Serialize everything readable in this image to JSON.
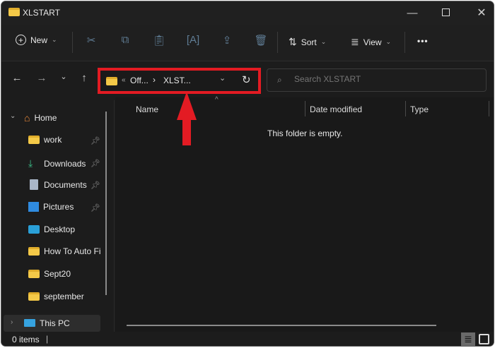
{
  "window": {
    "title": "XLSTART"
  },
  "toolbar": {
    "new_label": "New",
    "sort_label": "Sort",
    "view_label": "View",
    "more_label": "•••",
    "icons": [
      "plus-circle-icon",
      "cut-icon",
      "copy-icon",
      "paste-icon",
      "rename-icon",
      "share-icon",
      "delete-icon",
      "sort-icon",
      "view-icon",
      "more-icon"
    ]
  },
  "address": {
    "overflow": "«",
    "crumbs": [
      "Off...",
      "XLST..."
    ],
    "separator": "›"
  },
  "search": {
    "placeholder": "Search XLSTART"
  },
  "columns": [
    "Name",
    "Date modified",
    "Type"
  ],
  "empty_message": "This folder is empty.",
  "sidebar": {
    "home": "Home",
    "items": [
      {
        "label": "work",
        "icon": "folder-icon",
        "pinned": true
      },
      {
        "label": "Downloads",
        "icon": "download-icon",
        "pinned": true
      },
      {
        "label": "Documents",
        "icon": "documents-icon",
        "pinned": true
      },
      {
        "label": "Pictures",
        "icon": "pictures-icon",
        "pinned": true
      },
      {
        "label": "Desktop",
        "icon": "desktop-icon",
        "pinned": false
      },
      {
        "label": "How To Auto Fi",
        "icon": "folder-icon",
        "pinned": false
      },
      {
        "label": "Sept20",
        "icon": "folder-icon",
        "pinned": false
      },
      {
        "label": "september",
        "icon": "folder-icon",
        "pinned": false
      }
    ],
    "this_pc": "This PC"
  },
  "status": {
    "items": "0 items"
  },
  "colors": {
    "highlight": "#e31b23",
    "folder": "#f4c948",
    "background": "#1c1c1c"
  }
}
